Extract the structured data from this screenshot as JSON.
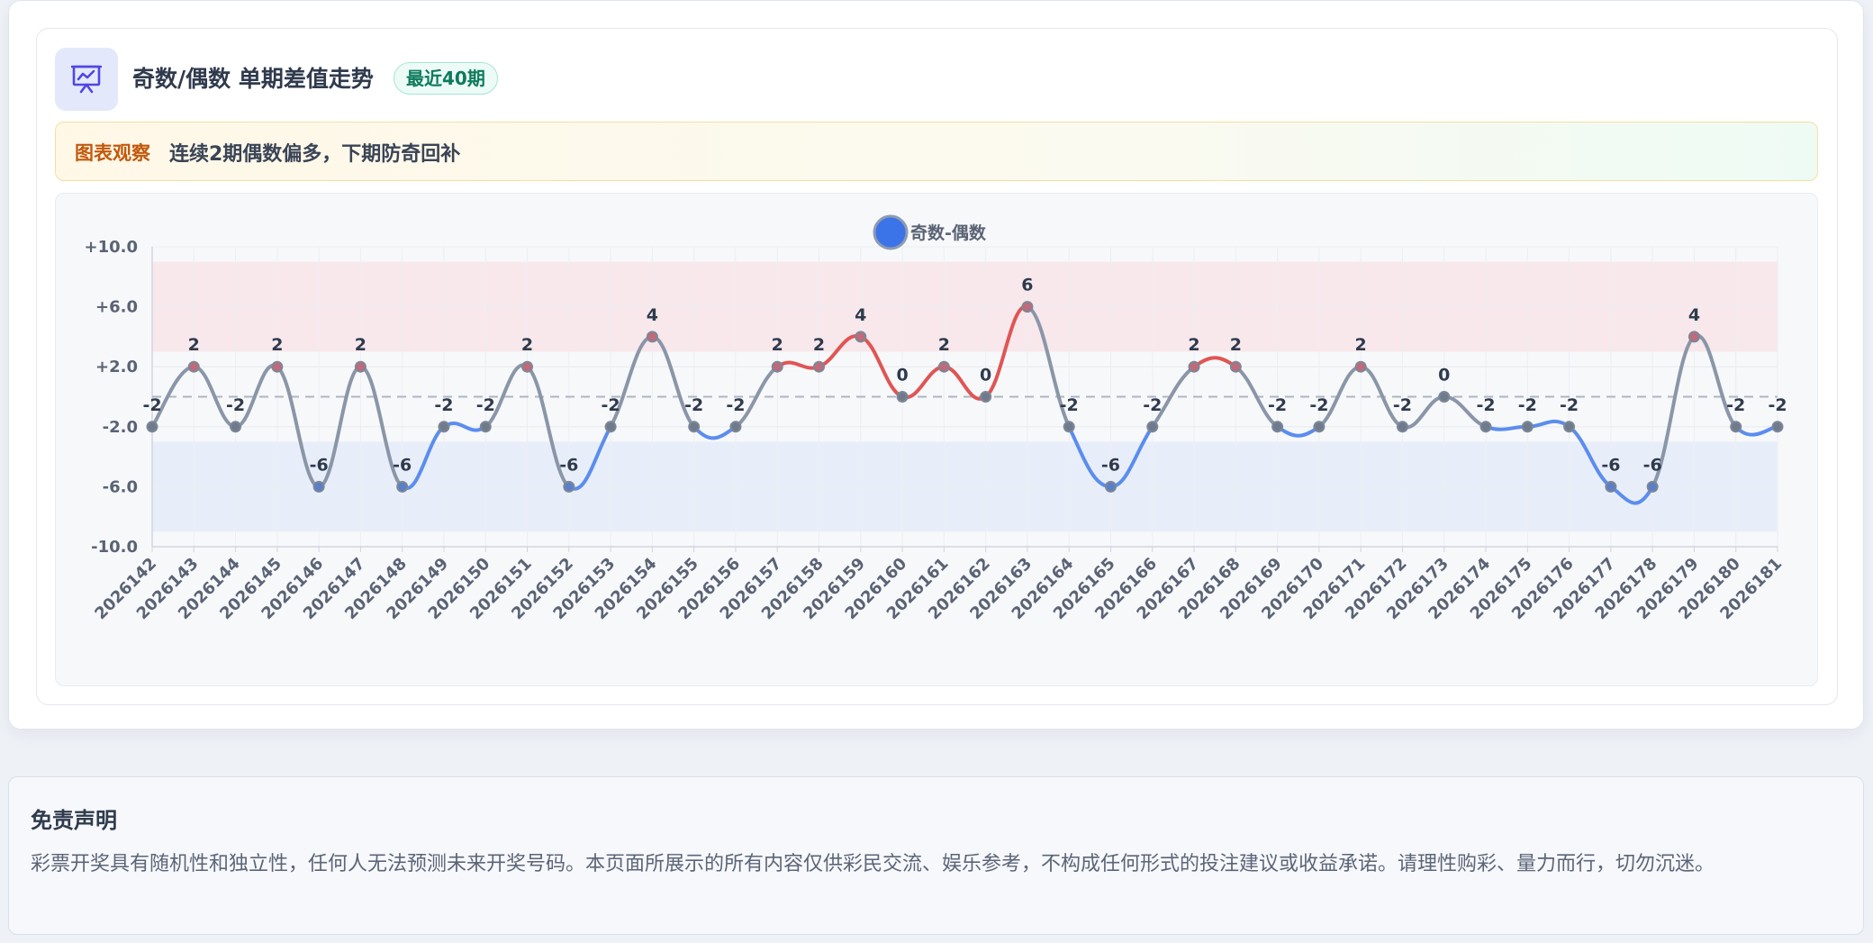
{
  "header": {
    "icon": "presentation-chart-icon",
    "title": "奇数/偶数 单期差值走势",
    "badge": "最近40期"
  },
  "insight": {
    "label": "图表观察",
    "text": "连续2期偶数偏多，下期防奇回补"
  },
  "disclaimer": {
    "title": "免责声明",
    "text": "彩票开奖具有随机性和独立性，任何人无法预测未来开奖号码。本页面所展示的所有内容仅供彩民交流、娱乐参考，不构成任何形式的投注建议或收益承诺。请理性购彩、量力而行，切勿沉迷。"
  },
  "colors": {
    "accent": "#3b73e8",
    "neutral_line": "#8a96a8",
    "high_line": "#e05555",
    "low_line": "#5b8def",
    "high_band": "#f8e8eb",
    "low_band": "#e8eef9"
  },
  "chart_data": {
    "type": "line",
    "legend": [
      "奇数-偶数"
    ],
    "legend_position": "top-center",
    "categories": [
      "2026142",
      "2026143",
      "2026144",
      "2026145",
      "2026146",
      "2026147",
      "2026148",
      "2026149",
      "2026150",
      "2026151",
      "2026152",
      "2026153",
      "2026154",
      "2026155",
      "2026156",
      "2026157",
      "2026158",
      "2026159",
      "2026160",
      "2026161",
      "2026162",
      "2026163",
      "2026164",
      "2026165",
      "2026166",
      "2026167",
      "2026168",
      "2026169",
      "2026170",
      "2026171",
      "2026172",
      "2026173",
      "2026174",
      "2026175",
      "2026176",
      "2026177",
      "2026178",
      "2026179",
      "2026180",
      "2026181"
    ],
    "series": [
      {
        "name": "奇数-偶数",
        "values": [
          -2,
          2,
          -2,
          2,
          -6,
          2,
          -6,
          -2,
          -2,
          2,
          -6,
          -2,
          4,
          -2,
          -2,
          2,
          2,
          4,
          0,
          2,
          0,
          6,
          -2,
          -6,
          -2,
          2,
          2,
          -2,
          -2,
          2,
          -2,
          0,
          -2,
          -2,
          -2,
          -6,
          -6,
          4,
          -2,
          -2
        ]
      }
    ],
    "yticks": [
      "+10.0",
      "+6.0",
      "+2.0",
      "-2.0",
      "-6.0",
      "-10.0"
    ],
    "ylim": [
      -10,
      10
    ],
    "reference_line": 0,
    "bands": [
      {
        "from": 3,
        "to": 9,
        "color": "#f8e8eb"
      },
      {
        "from": -9,
        "to": -3,
        "color": "#e8eef9"
      }
    ],
    "grid": true
  }
}
